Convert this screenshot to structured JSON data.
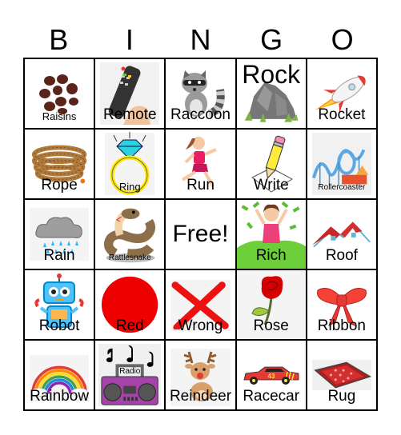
{
  "header": {
    "letters": [
      "B",
      "I",
      "N",
      "G",
      "O"
    ]
  },
  "card": {
    "free_label": "Free!",
    "rows": [
      [
        {
          "label": "Raisins",
          "icon": "raisins-icon"
        },
        {
          "label": "Remote",
          "icon": "remote-control-icon"
        },
        {
          "label": "Raccoon",
          "icon": "raccoon-icon"
        },
        {
          "label": "Rock",
          "icon": "rock-icon"
        },
        {
          "label": "Rocket",
          "icon": "rocket-icon"
        }
      ],
      [
        {
          "label": "Rope",
          "icon": "rope-icon"
        },
        {
          "label": "Ring",
          "icon": "ring-icon"
        },
        {
          "label": "Run",
          "icon": "runner-icon"
        },
        {
          "label": "Write",
          "icon": "pencil-icon"
        },
        {
          "label": "Rollercoaster",
          "icon": "rollercoaster-icon"
        }
      ],
      [
        {
          "label": "Rain",
          "icon": "rain-cloud-icon"
        },
        {
          "label": "Rattlesnake",
          "icon": "rattlesnake-icon"
        },
        {
          "label": "Free!",
          "icon": "free-space"
        },
        {
          "label": "Rich",
          "icon": "money-pile-icon"
        },
        {
          "label": "Roof",
          "icon": "roof-icon"
        }
      ],
      [
        {
          "label": "Robot",
          "icon": "robot-icon"
        },
        {
          "label": "Red",
          "icon": "red-circle-icon"
        },
        {
          "label": "Wrong",
          "icon": "red-x-icon"
        },
        {
          "label": "Rose",
          "icon": "rose-icon"
        },
        {
          "label": "Ribbon",
          "icon": "ribbon-bow-icon"
        }
      ],
      [
        {
          "label": "Rainbow",
          "icon": "rainbow-icon"
        },
        {
          "label": "Radio",
          "icon": "boombox-radio-icon"
        },
        {
          "label": "Reindeer",
          "icon": "reindeer-icon"
        },
        {
          "label": "Racecar",
          "icon": "racecar-icon"
        },
        {
          "label": "Rug",
          "icon": "rug-icon"
        }
      ]
    ],
    "colors": {
      "grid_line": "#000000",
      "red": "#ee0000",
      "accent_blue": "#3db8e0"
    }
  }
}
